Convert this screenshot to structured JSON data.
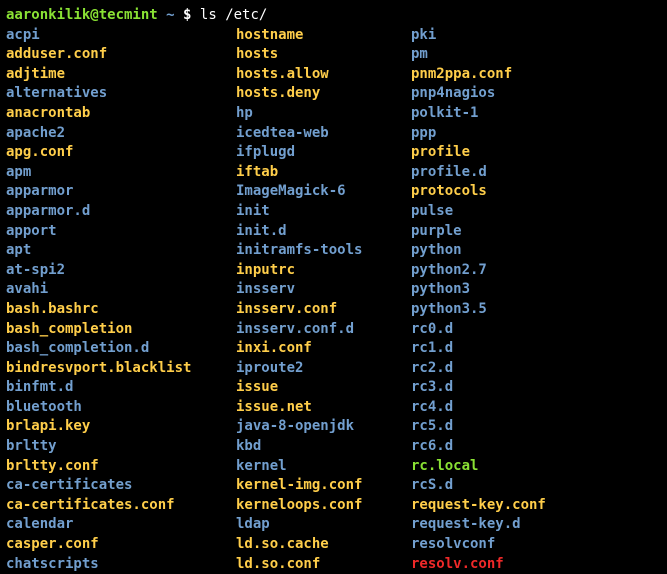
{
  "prompt": {
    "user_host": "aaronkilik@tecmint",
    "tilde": "~",
    "dollar": "$",
    "command": "ls /etc/"
  },
  "listing": {
    "col1": [
      {
        "name": "acpi",
        "type": "dir"
      },
      {
        "name": "adduser.conf",
        "type": "file"
      },
      {
        "name": "adjtime",
        "type": "file"
      },
      {
        "name": "alternatives",
        "type": "dir"
      },
      {
        "name": "anacrontab",
        "type": "file"
      },
      {
        "name": "apache2",
        "type": "dir"
      },
      {
        "name": "apg.conf",
        "type": "file"
      },
      {
        "name": "apm",
        "type": "dir"
      },
      {
        "name": "apparmor",
        "type": "dir"
      },
      {
        "name": "apparmor.d",
        "type": "dir"
      },
      {
        "name": "apport",
        "type": "dir"
      },
      {
        "name": "apt",
        "type": "dir"
      },
      {
        "name": "at-spi2",
        "type": "dir"
      },
      {
        "name": "avahi",
        "type": "dir"
      },
      {
        "name": "bash.bashrc",
        "type": "file"
      },
      {
        "name": "bash_completion",
        "type": "file"
      },
      {
        "name": "bash_completion.d",
        "type": "dir"
      },
      {
        "name": "bindresvport.blacklist",
        "type": "file"
      },
      {
        "name": "binfmt.d",
        "type": "dir"
      },
      {
        "name": "bluetooth",
        "type": "dir"
      },
      {
        "name": "brlapi.key",
        "type": "file"
      },
      {
        "name": "brltty",
        "type": "dir"
      },
      {
        "name": "brltty.conf",
        "type": "file"
      },
      {
        "name": "ca-certificates",
        "type": "dir"
      },
      {
        "name": "ca-certificates.conf",
        "type": "file"
      },
      {
        "name": "calendar",
        "type": "dir"
      },
      {
        "name": "casper.conf",
        "type": "file"
      },
      {
        "name": "chatscripts",
        "type": "dir"
      }
    ],
    "col2": [
      {
        "name": "hostname",
        "type": "file"
      },
      {
        "name": "hosts",
        "type": "file"
      },
      {
        "name": "hosts.allow",
        "type": "file"
      },
      {
        "name": "hosts.deny",
        "type": "file"
      },
      {
        "name": "hp",
        "type": "dir"
      },
      {
        "name": "icedtea-web",
        "type": "dir"
      },
      {
        "name": "ifplugd",
        "type": "dir"
      },
      {
        "name": "iftab",
        "type": "file"
      },
      {
        "name": "ImageMagick-6",
        "type": "dir"
      },
      {
        "name": "init",
        "type": "dir"
      },
      {
        "name": "init.d",
        "type": "dir"
      },
      {
        "name": "initramfs-tools",
        "type": "dir"
      },
      {
        "name": "inputrc",
        "type": "file"
      },
      {
        "name": "insserv",
        "type": "dir"
      },
      {
        "name": "insserv.conf",
        "type": "file"
      },
      {
        "name": "insserv.conf.d",
        "type": "dir"
      },
      {
        "name": "inxi.conf",
        "type": "file"
      },
      {
        "name": "iproute2",
        "type": "dir"
      },
      {
        "name": "issue",
        "type": "file"
      },
      {
        "name": "issue.net",
        "type": "file"
      },
      {
        "name": "java-8-openjdk",
        "type": "dir"
      },
      {
        "name": "kbd",
        "type": "dir"
      },
      {
        "name": "kernel",
        "type": "dir"
      },
      {
        "name": "kernel-img.conf",
        "type": "file"
      },
      {
        "name": "kerneloops.conf",
        "type": "file"
      },
      {
        "name": "ldap",
        "type": "dir"
      },
      {
        "name": "ld.so.cache",
        "type": "file"
      },
      {
        "name": "ld.so.conf",
        "type": "file"
      }
    ],
    "col3": [
      {
        "name": "pki",
        "type": "dir"
      },
      {
        "name": "pm",
        "type": "dir"
      },
      {
        "name": "pnm2ppa.conf",
        "type": "file"
      },
      {
        "name": "pnp4nagios",
        "type": "dir"
      },
      {
        "name": "polkit-1",
        "type": "dir"
      },
      {
        "name": "ppp",
        "type": "dir"
      },
      {
        "name": "profile",
        "type": "file"
      },
      {
        "name": "profile.d",
        "type": "dir"
      },
      {
        "name": "protocols",
        "type": "file"
      },
      {
        "name": "pulse",
        "type": "dir"
      },
      {
        "name": "purple",
        "type": "dir"
      },
      {
        "name": "python",
        "type": "dir"
      },
      {
        "name": "python2.7",
        "type": "dir"
      },
      {
        "name": "python3",
        "type": "dir"
      },
      {
        "name": "python3.5",
        "type": "dir"
      },
      {
        "name": "rc0.d",
        "type": "dir"
      },
      {
        "name": "rc1.d",
        "type": "dir"
      },
      {
        "name": "rc2.d",
        "type": "dir"
      },
      {
        "name": "rc3.d",
        "type": "dir"
      },
      {
        "name": "rc4.d",
        "type": "dir"
      },
      {
        "name": "rc5.d",
        "type": "dir"
      },
      {
        "name": "rc6.d",
        "type": "dir"
      },
      {
        "name": "rc.local",
        "type": "exec"
      },
      {
        "name": "rcS.d",
        "type": "dir"
      },
      {
        "name": "request-key.conf",
        "type": "file"
      },
      {
        "name": "request-key.d",
        "type": "dir"
      },
      {
        "name": "resolvconf",
        "type": "dir"
      },
      {
        "name": "resolv.conf",
        "type": "special"
      }
    ]
  }
}
